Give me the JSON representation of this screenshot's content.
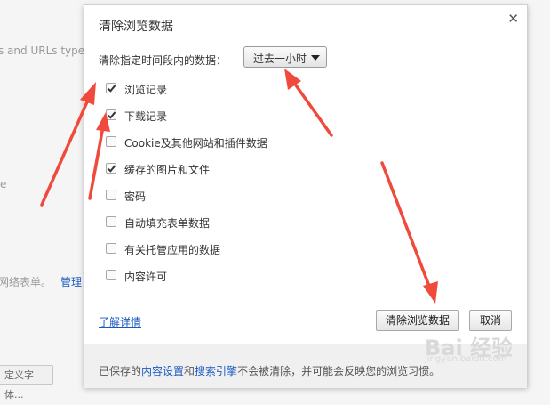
{
  "background": {
    "text_1": "s and URLs typed i",
    "text_2": "e",
    "text_3": "网络表单。",
    "link_manage": "管理",
    "button_partial": "定义字体..."
  },
  "dialog": {
    "title": "清除浏览数据",
    "close_icon": "close-icon",
    "range_label": "清除指定时间段内的数据：",
    "range_value": "过去一小时",
    "options": [
      {
        "label": "浏览记录",
        "checked": true
      },
      {
        "label": "下载记录",
        "checked": true
      },
      {
        "label": "Cookie及其他网站和插件数据",
        "checked": false
      },
      {
        "label": "缓存的图片和文件",
        "checked": true
      },
      {
        "label": "密码",
        "checked": false
      },
      {
        "label": "自动填充表单数据",
        "checked": false
      },
      {
        "label": "有关托管应用的数据",
        "checked": false
      },
      {
        "label": "内容许可",
        "checked": false
      }
    ],
    "learn_more": "了解详情",
    "clear_button": "清除浏览数据",
    "cancel_button": "取消",
    "footer": {
      "prefix": "已保存的",
      "link1": "内容设置",
      "mid": "和",
      "link2": "搜索引擎",
      "suffix": "不会被清除，并可能会反映您的浏览习惯。"
    }
  },
  "watermark": {
    "text": "Bai 经验",
    "sub": "jingyan.baidu.com"
  },
  "colors": {
    "arrow": "#f04a3c",
    "link": "#1a5ac0"
  }
}
